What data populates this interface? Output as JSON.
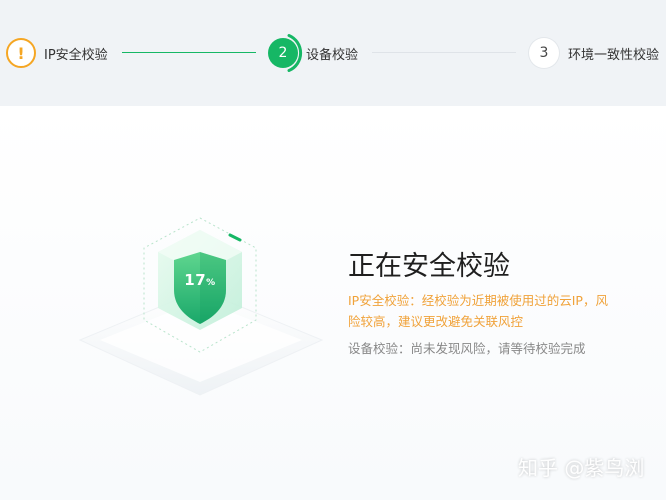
{
  "steps": [
    {
      "index": "!",
      "label": "IP安全校验",
      "state": "warning"
    },
    {
      "index": "2",
      "label": "设备校验",
      "state": "active"
    },
    {
      "index": "3",
      "label": "环境一致性校验",
      "state": "pending"
    }
  ],
  "progress": {
    "value": "17",
    "unit": "%"
  },
  "main": {
    "title": "正在安全校验",
    "ip_warning": "IP安全校验：经校验为近期被使用过的云IP，风险较高，建议更改避免关联风控",
    "device_status": "设备校验：尚未发现风险，请等待校验完成"
  },
  "watermark": "知乎 @紫鸟浏",
  "colors": {
    "accent_green": "#16b765",
    "warning_orange": "#f5a623",
    "warning_text": "#f0a23a"
  },
  "icons": {
    "step1": "exclamation-icon",
    "shield": "shield-icon"
  }
}
